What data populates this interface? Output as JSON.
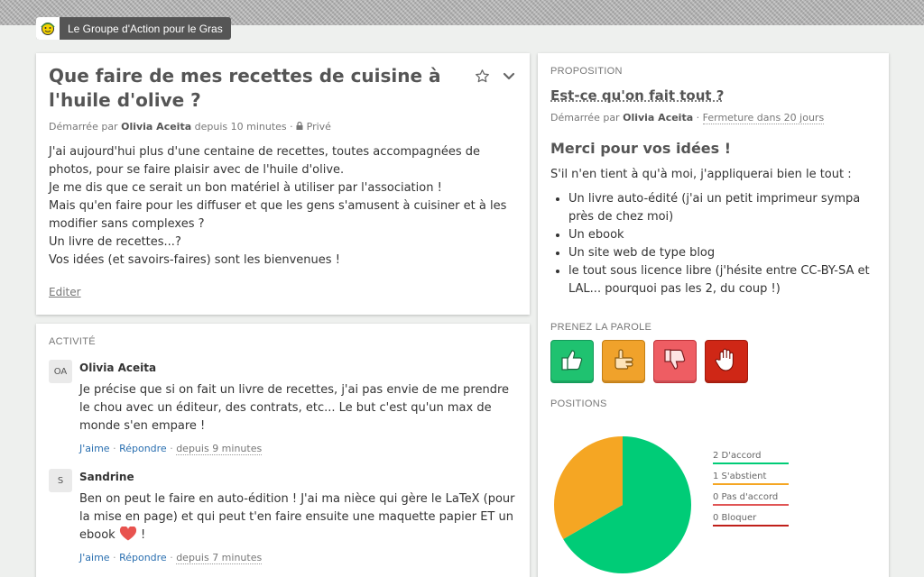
{
  "group": {
    "name": "Le Groupe d'Action pour le Gras"
  },
  "discussion": {
    "title": "Que faire de mes recettes de cuisine à l'huile d'olive ?",
    "meta_prefix": "Démarrée par",
    "author": "Olivia Aceita",
    "time": "depuis 10 minutes",
    "separator": "·",
    "privacy": "Privé",
    "body": [
      "J'ai aujourd'hui plus d'une centaine de recettes, toutes accompagnées de photos, pour se faire plaisir avec de l'huile d'olive.",
      "Je me dis que ce serait un bon matériel à utiliser par l'association !",
      "Mais qu'en faire pour les diffuser et que les gens s'amusent à cuisiner et à les modifier sans complexes ?",
      "Un livre de recettes...?",
      "Vos idées (et savoirs-faires) sont les bienvenues !"
    ],
    "edit_label": "Editer"
  },
  "activity": {
    "label": "ACTIVITÉ",
    "comments": [
      {
        "initials": "OA",
        "author": "Olivia Aceita",
        "text": "Je précise que si on fait un livre de recettes, j'ai pas envie de me prendre le chou avec un éditeur, des contrats, etc... Le but c'est qu'un max de monde s'en empare !",
        "like": "J'aime",
        "reply": "Répondre",
        "time": "depuis 9 minutes"
      },
      {
        "initials": "S",
        "author": "Sandrine",
        "text": "Ben on peut le faire en auto-édition ! J'ai ma nièce qui gère le LaTeX (pour la mise en page) et qui peut t'en faire ensuite une maquette papier ET un ebook",
        "text_end": "!",
        "like": "J'aime",
        "reply": "Répondre",
        "time": "depuis 7 minutes"
      }
    ],
    "dot": "·"
  },
  "proposal": {
    "label": "PROPOSITION",
    "title": "Est-ce qu'on fait tout ?",
    "meta_prefix": "Démarrée par",
    "author": "Olivia Aceita",
    "separator": "·",
    "closing": "Fermeture dans 20 jours",
    "heading": "Merci pour vos idées !",
    "intro": "S'il n'en tient à qu'à moi, j'appliquerai bien le tout :",
    "items": [
      "Un livre auto-édité (j'ai un petit imprimeur sympa près de chez moi)",
      "Un ebook",
      "Un site web de type blog",
      "le tout sous licence libre (j'hésite entre CC-BY-SA et LAL... pourquoi pas les 2, du coup !)"
    ],
    "speak_label": "PRENEZ LA PAROLE",
    "votes": [
      {
        "icon": "thumbs-up-icon",
        "color": "#1fc270",
        "border": "#15995a"
      },
      {
        "icon": "hand-flat-icon",
        "color": "#f0a22b",
        "border": "#c47f14"
      },
      {
        "icon": "thumbs-down-icon",
        "color": "#ee5d63",
        "border": "#c2343a"
      },
      {
        "icon": "raised-hand-icon",
        "color": "#cf2716",
        "border": "#a21a0c"
      }
    ],
    "positions_label": "POSITIONS",
    "legend": [
      {
        "label": "2 D'accord",
        "color": "#00cc77"
      },
      {
        "label": "1 S'abstient",
        "color": "#f5a623"
      },
      {
        "label": "0 Pas d'accord",
        "color": "#e05555"
      },
      {
        "label": "0 Bloquer",
        "color": "#c0201a"
      }
    ]
  },
  "chart_data": {
    "type": "pie",
    "categories": [
      "D'accord",
      "S'abstient",
      "Pas d'accord",
      "Bloquer"
    ],
    "values": [
      2,
      1,
      0,
      0
    ],
    "colors": [
      "#00cc77",
      "#f5a623",
      "#e05555",
      "#c0201a"
    ]
  }
}
